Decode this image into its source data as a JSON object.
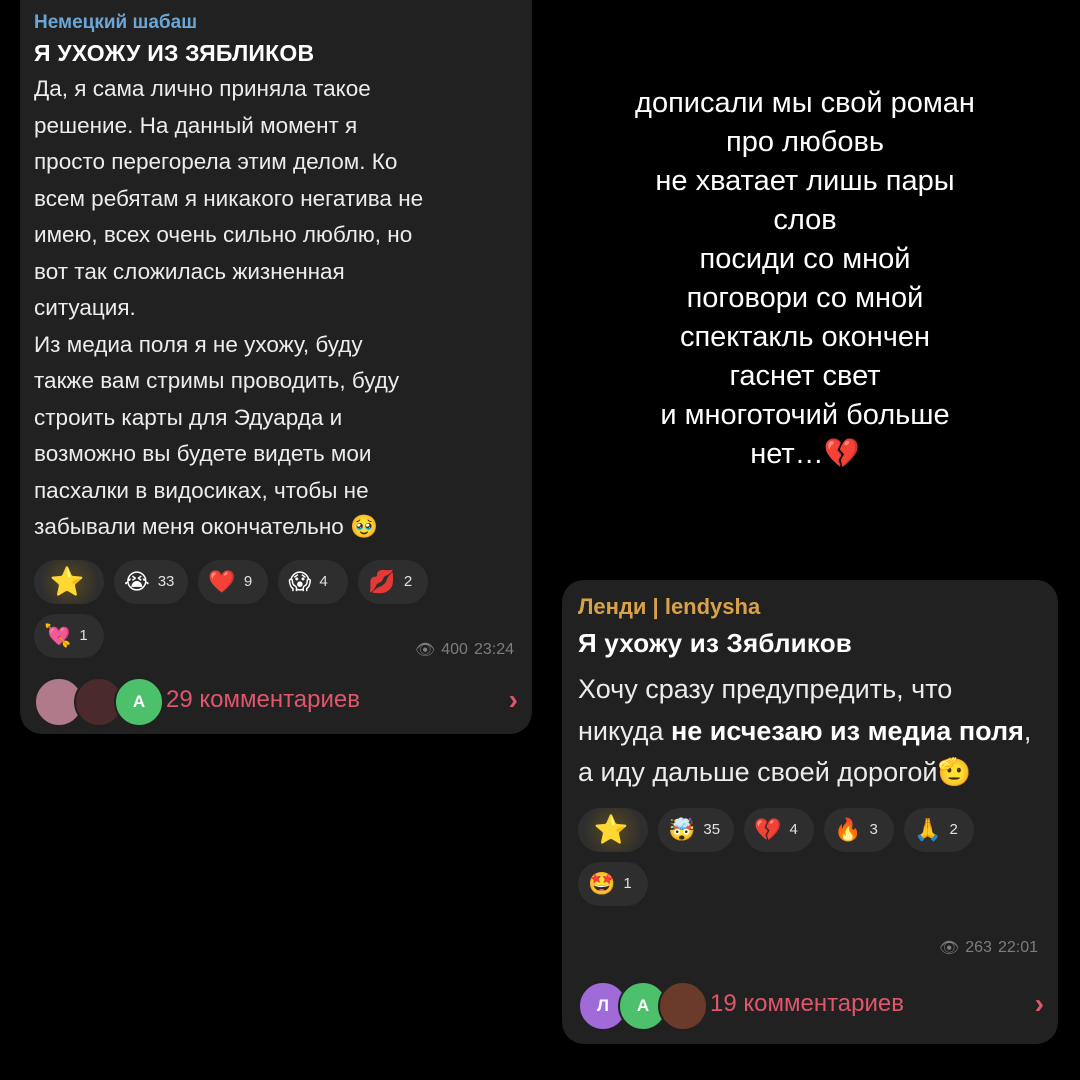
{
  "post1": {
    "channel": "Немецкий шабаш",
    "title": "Я УХОЖУ ИЗ ЗЯБЛИКОВ",
    "body_lines": [
      "Да, я сама лично приняла такое",
      "решение. На данный момент я",
      "просто перегорела этим делом. Ко",
      "всем ребятам я никакого негатива не",
      "имею, всех очень сильно люблю, но",
      "вот так сложилась жизненная",
      "ситуация.",
      "Из медиа поля я не ухожу, буду",
      "также вам стримы проводить, буду",
      "строить карты для Эдуарда и",
      "возможно вы будете видеть мои",
      "пасхалки в видосиках, чтобы не",
      "забывали меня окончательно 🥹"
    ],
    "reactions": [
      {
        "emoji": "⭐",
        "count": "",
        "icon": "star-icon"
      },
      {
        "emoji": "😭",
        "count": "33",
        "icon": "crying-face-icon"
      },
      {
        "emoji": "❤️",
        "count": "9",
        "icon": "heart-icon"
      },
      {
        "emoji": "😱",
        "count": "4",
        "icon": "screaming-face-icon"
      },
      {
        "emoji": "💋",
        "count": "2",
        "icon": "kiss-mark-icon"
      },
      {
        "emoji": "💘",
        "count": "1",
        "icon": "heart-arrow-icon"
      }
    ],
    "views": "400",
    "time": "23:24",
    "comments_label": "29 комментариев",
    "avatars": [
      {
        "letter": "",
        "color": "#b07a8a"
      },
      {
        "letter": "",
        "color": "#4a2a2a"
      },
      {
        "letter": "А",
        "color": "#4cc06a"
      }
    ]
  },
  "post2": {
    "channel": "Ленди | lendysha",
    "title": "Я ухожу из Зябликов",
    "body_parts": [
      {
        "text": " Хочу сразу предупредить, что никуда ",
        "bold": false
      },
      {
        "text": "не исчезаю из медиа поля",
        "bold": true
      },
      {
        "text": ", а иду дальше своей дорогой🫡",
        "bold": false
      }
    ],
    "reactions": [
      {
        "emoji": "⭐",
        "count": "",
        "icon": "star-icon"
      },
      {
        "emoji": "🤯",
        "count": "35",
        "icon": "exploding-head-icon"
      },
      {
        "emoji": "💔",
        "count": "4",
        "icon": "sparkle-heart-icon"
      },
      {
        "emoji": "🔥",
        "count": "3",
        "icon": "fire-icon"
      },
      {
        "emoji": "🙏",
        "count": "2",
        "icon": "folded-hands-icon"
      },
      {
        "emoji": "🤩",
        "count": "1",
        "icon": "star-struck-icon"
      }
    ],
    "views": "263",
    "time": "22:01",
    "comments_label": "19 комментариев",
    "avatars": [
      {
        "letter": "Л",
        "color": "#a06ad8"
      },
      {
        "letter": "А",
        "color": "#4cc06a"
      },
      {
        "letter": "",
        "color": "#6a3a2a"
      }
    ]
  },
  "lyrics": [
    "дописали мы свой роман",
    "про любовь",
    "не хватает лишь пары",
    "слов",
    "посиди со мной",
    "поговори со мной",
    "спектакль окончен",
    "гаснет свет",
    "и многоточий больше",
    "нет…💔"
  ],
  "colors": {
    "card_bg": "#212121",
    "channel1": "#6ba6d6",
    "channel2": "#d9a24a",
    "comments_accent": "#e0566b"
  }
}
